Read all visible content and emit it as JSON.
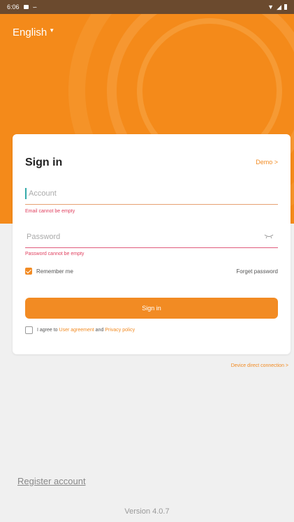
{
  "status_bar": {
    "time": "6:06"
  },
  "header": {
    "language": "English"
  },
  "card": {
    "title": "Sign in",
    "demo_link": "Demo >",
    "account_placeholder": "Account",
    "account_error": "Email cannot be empty",
    "password_placeholder": "Password",
    "password_error": "Password cannot be empty",
    "remember_label": "Remember me",
    "remember_checked": true,
    "forgot_label": "Forget password",
    "signin_label": "Sign in",
    "agree_prefix": "I agree to ",
    "user_agreement": "User agreement",
    "agree_and": " and ",
    "privacy_policy": "Privacy policy"
  },
  "device_direct": "Device direct connection >",
  "register_label": "Register account",
  "version": "Version 4.0.7",
  "colors": {
    "accent": "#f28b23",
    "hero": "#f48a1a",
    "error": "#e0405f"
  }
}
